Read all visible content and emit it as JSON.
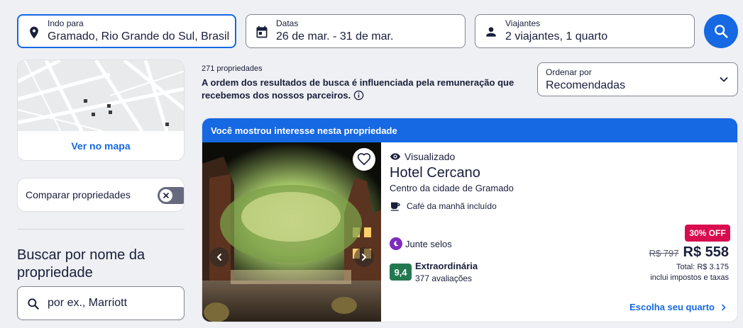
{
  "search": {
    "destination": {
      "label": "Indo para",
      "value": "Gramado, Rio Grande do Sul, Brasil"
    },
    "dates": {
      "label": "Datas",
      "value": "26 de mar. - 31 de mar."
    },
    "travelers": {
      "label": "Viajantes",
      "value": "2 viajantes, 1 quarto"
    }
  },
  "sidebar": {
    "map_link": "Ver no mapa",
    "compare_label": "Comparar propriedades",
    "name_search_heading": "Buscar por nome da propriedade",
    "name_search_placeholder": "por ex., Marriott"
  },
  "results": {
    "count": "271 propriedades",
    "disclaimer": "A ordem dos resultados de busca é influenciada pela remuneração que recebemos dos nossos parceiros.",
    "sort_label": "Ordenar por",
    "sort_value": "Recomendadas"
  },
  "property": {
    "banner": "Você mostrou interesse nesta propriedade",
    "viewed": "Visualizado",
    "name": "Hotel Cercano",
    "location": "Centro da cidade de Gramado",
    "amenity": "Café da manhã incluído",
    "loyalty": "Junte selos",
    "rating": "9,4",
    "rating_word": "Extraordinária",
    "reviews": "377 avaliações",
    "discount": "30% OFF",
    "old_price": "R$ 797",
    "new_price": "R$ 558",
    "total": "Total: R$ 3.175",
    "taxes": "inclui impostos e taxas",
    "cta": "Escolha seu quarto"
  },
  "colors": {
    "primary": "#1668e3",
    "rating_green": "#227950",
    "discount_red": "#d90c4f",
    "loyalty_purple": "#7b2cbf"
  }
}
